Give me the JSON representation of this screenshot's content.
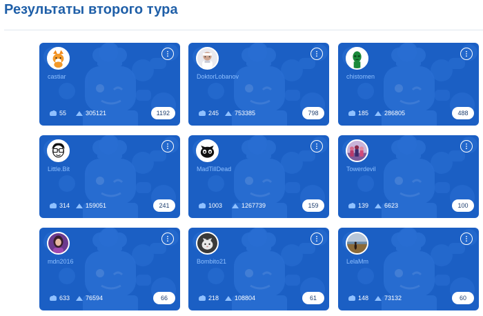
{
  "page": {
    "title": "Результаты второго тура"
  },
  "colors": {
    "card_bg": "#1b5fc4",
    "title": "#1f5fa8",
    "username": "#8fc0ff"
  },
  "icons": {
    "menu": "more-vertical-icon",
    "stat1": "pie-crust-icon",
    "stat2": "triangle-icon"
  },
  "cards": [
    {
      "username": "castiar",
      "stat1": "55",
      "stat2": "305121",
      "score": "1192",
      "avatar": "fox-avatar"
    },
    {
      "username": "DoktorLobanov",
      "stat1": "245",
      "stat2": "753385",
      "score": "798",
      "avatar": "doctor-avatar"
    },
    {
      "username": "chistomen",
      "stat1": "185",
      "stat2": "286805",
      "score": "488",
      "avatar": "green-mask-avatar"
    },
    {
      "username": "Little.Bit",
      "stat1": "314",
      "stat2": "159051",
      "score": "241",
      "avatar": "glasses-avatar"
    },
    {
      "username": "MadTillDead",
      "stat1": "1003",
      "stat2": "1267739",
      "score": "159",
      "avatar": "cat-avatar"
    },
    {
      "username": "Towerdevil",
      "stat1": "139",
      "stat2": "6623",
      "score": "100",
      "avatar": "group-photo-avatar"
    },
    {
      "username": "mdn2016",
      "stat1": "633",
      "stat2": "76594",
      "score": "66",
      "avatar": "woman-avatar"
    },
    {
      "username": "Bombito21",
      "stat1": "218",
      "stat2": "108804",
      "score": "61",
      "avatar": "dark-cat-avatar"
    },
    {
      "username": "LelaMm",
      "stat1": "148",
      "stat2": "73132",
      "score": "60",
      "avatar": "landscape-avatar"
    }
  ]
}
